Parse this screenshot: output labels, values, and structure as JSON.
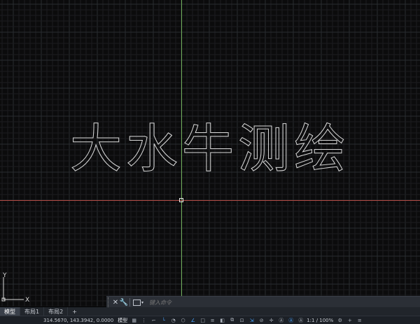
{
  "drawing": {
    "text": "大水牛测绘",
    "background": "#0b0b0c",
    "grid_minor_color": "#1c1d20",
    "grid_major_color": "#2a2c31",
    "crosshair_vertical_color": "#6fae5a",
    "crosshair_horizontal_color": "#b04a44",
    "text_outline_color": "#d9d9d9"
  },
  "ucs": {
    "x_label": "X",
    "y_label": "Y"
  },
  "command_line": {
    "close_icon": "close-icon",
    "settings_icon": "wrench-icon",
    "placeholder": "键入命令"
  },
  "tabs": [
    {
      "label": "模型",
      "active": true
    },
    {
      "label": "布局1",
      "active": false
    },
    {
      "label": "布局2",
      "active": false
    },
    {
      "label": "+",
      "active": false
    }
  ],
  "status": {
    "coordinates": "314.5670, 143.3942, 0.0000",
    "model_label": "模型",
    "zoom": "1:1 / 100%"
  }
}
